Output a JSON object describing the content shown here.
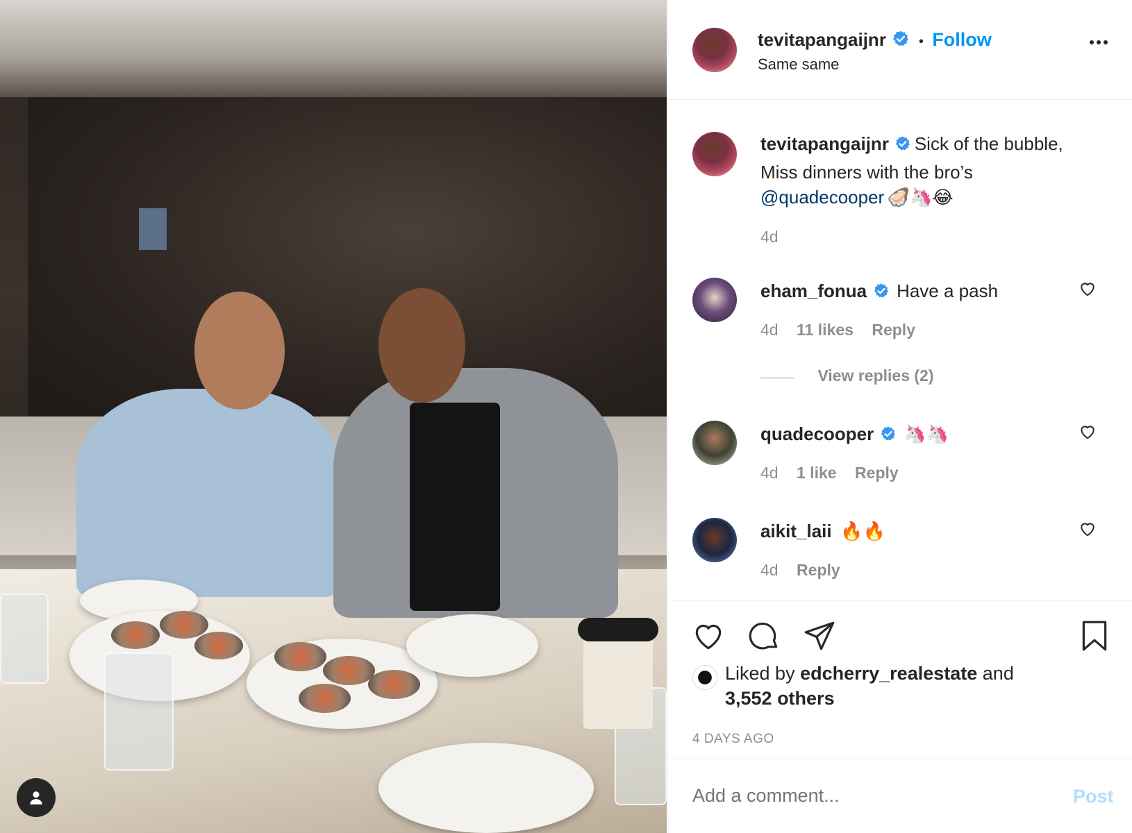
{
  "post": {
    "author": "tevitapangaijnr",
    "follow_label": "Follow",
    "dot_separator": "•",
    "location": "Same same"
  },
  "caption": {
    "author": "tevitapangaijnr",
    "text_line1": "Sick of the bubble,",
    "text_line2": "Miss dinners with the bro’s",
    "mention": "@quadecooper",
    "emojis": "🦪🦄😂",
    "time": "4d"
  },
  "comments": [
    {
      "username": "eham_fonua",
      "verified": true,
      "text": "Have a pash",
      "time": "4d",
      "likes": "11 likes",
      "reply_label": "Reply",
      "view_replies": "View replies (2)"
    },
    {
      "username": "quadecooper",
      "verified": true,
      "text": "🦄🦄",
      "time": "4d",
      "likes": "1 like",
      "reply_label": "Reply"
    },
    {
      "username": "aikit_laii",
      "verified": false,
      "text": "🔥🔥",
      "time": "4d",
      "reply_label": "Reply"
    }
  ],
  "likes": {
    "prefix": "Liked by",
    "user": "edcherry_realestate",
    "connector": "and",
    "others": "3,552 others"
  },
  "timestamp": "4 DAYS AGO",
  "comment_input": {
    "placeholder": "Add a comment...",
    "post_label": "Post"
  },
  "colors": {
    "accent": "#0095f6",
    "verified": "#3897f0",
    "post_disabled": "#b2dffc",
    "muted": "#8e8e8e"
  },
  "icons": [
    "verified-badge-icon",
    "more-options-icon",
    "heart-icon",
    "comment-icon",
    "share-icon",
    "bookmark-icon",
    "user-icon"
  ]
}
